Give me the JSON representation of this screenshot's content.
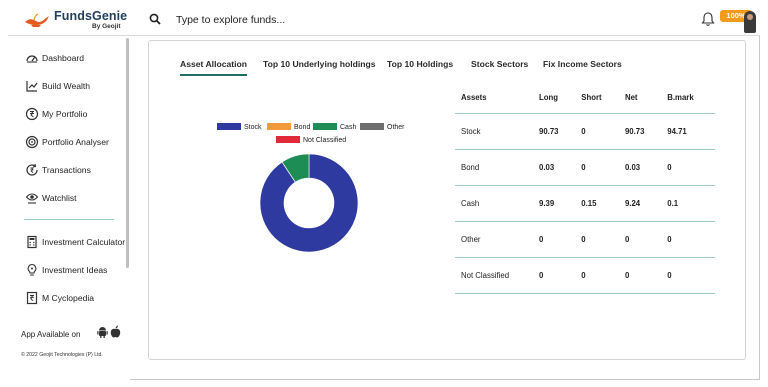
{
  "header": {
    "brand": "FundsGenie",
    "brand_sub": "By Geojit",
    "search_placeholder": "Type to explore funds...",
    "progress_badge": "100%"
  },
  "sidebar": {
    "items": [
      {
        "label": "Dashboard",
        "icon": "dashboard-icon"
      },
      {
        "label": "Build Wealth",
        "icon": "chart-up-icon"
      },
      {
        "label": "My Portfolio",
        "icon": "rupee-circle-icon"
      },
      {
        "label": "Portfolio Analyser",
        "icon": "target-icon"
      },
      {
        "label": "Transactions",
        "icon": "refresh-rupee-icon"
      },
      {
        "label": "Watchlist",
        "icon": "eye-icon"
      },
      {
        "label": "Investment Calculator",
        "icon": "calculator-icon"
      },
      {
        "label": "Investment Ideas",
        "icon": "bulb-icon"
      },
      {
        "label": "M Cyclopedia",
        "icon": "book-icon"
      }
    ],
    "app_available": "App Available on",
    "copyright": "© 2022 Geojit Technologies (P) Ltd."
  },
  "tabs": [
    {
      "label": "Asset Allocation",
      "active": true
    },
    {
      "label": "Top 10 Underlying holdings",
      "active": false
    },
    {
      "label": "Top 10 Holdings",
      "active": false
    },
    {
      "label": "Stock Sectors",
      "active": false
    },
    {
      "label": "Fix Income Sectors",
      "active": false
    }
  ],
  "chart_data": {
    "type": "pie",
    "donut": true,
    "legend_position": "top",
    "categories": [
      "Stock",
      "Bond",
      "Cash",
      "Other",
      "Not Classified"
    ],
    "values": [
      90.73,
      0.03,
      9.24,
      0,
      0
    ],
    "colors": [
      "#2f3aa0",
      "#f39a3d",
      "#1d8d55",
      "#6e6e6e",
      "#e02a3a"
    ]
  },
  "table": {
    "headers": [
      "Assets",
      "Long",
      "Short",
      "Net",
      "B.mark"
    ],
    "rows": [
      [
        "Stock",
        "90.73",
        "0",
        "90.73",
        "94.71"
      ],
      [
        "Bond",
        "0.03",
        "0",
        "0.03",
        "0"
      ],
      [
        "Cash",
        "9.39",
        "0.15",
        "9.24",
        "0.1"
      ],
      [
        "Other",
        "0",
        "0",
        "0",
        "0"
      ],
      [
        "Not Classified",
        "0",
        "0",
        "0",
        "0"
      ]
    ]
  }
}
